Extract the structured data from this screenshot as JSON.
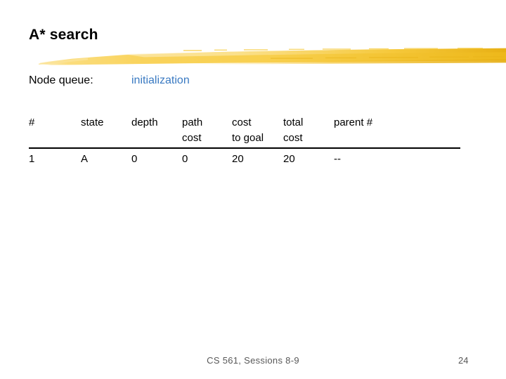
{
  "slide": {
    "title": "A* search",
    "page_number": "24",
    "footer": "CS 561, Sessions 8-9"
  },
  "decoration": {
    "brush_stroke_name": "yellow-brush-stroke",
    "colors": {
      "light_gold": "#fbe08a",
      "gold": "#f7cf48",
      "deep_gold": "#eeb81d",
      "pale_gold": "#fdeec0"
    }
  },
  "queue": {
    "label": "Node queue:",
    "value": "initialization",
    "value_color": "#3a7ac2"
  },
  "table": {
    "headers": [
      {
        "line1": "#",
        "line2": ""
      },
      {
        "line1": "state",
        "line2": ""
      },
      {
        "line1": "depth",
        "line2": ""
      },
      {
        "line1": "path",
        "line2": "cost"
      },
      {
        "line1": "cost",
        "line2": "to goal"
      },
      {
        "line1": "total",
        "line2": "cost"
      },
      {
        "line1": "parent #",
        "line2": ""
      }
    ],
    "rows": [
      {
        "num": "1",
        "state": "A",
        "depth": "0",
        "path_cost": "0",
        "cost_to_goal": "20",
        "total_cost": "20",
        "parent": "--"
      }
    ]
  }
}
